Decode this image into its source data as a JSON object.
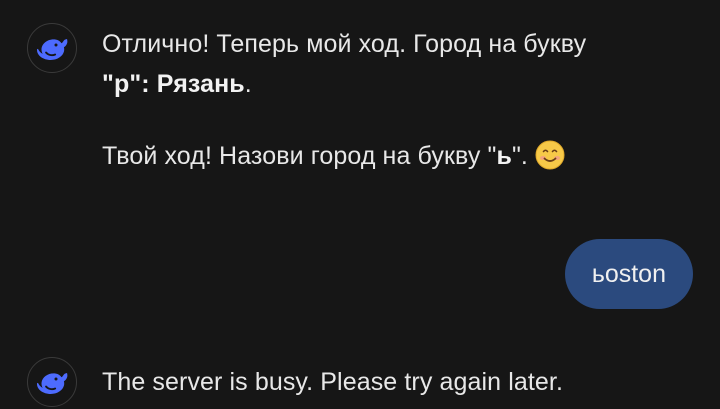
{
  "messages": {
    "bot1": {
      "line1": "Отлично! Теперь мой ход. Город на букву",
      "q1": "\"",
      "letter1": "р",
      "q2": "\": ",
      "city": "Рязань",
      "dot1": ".",
      "line3a": "Твой ход! Назови город на букву \"",
      "letter2": "ь",
      "line3b": "\". ",
      "emoji": "smiling-face-emoji"
    },
    "user1": {
      "text": "ьoston"
    },
    "bot2": {
      "text": "The server is busy. Please try again later."
    }
  },
  "icons": {
    "avatar": "deepseek-whale-icon"
  },
  "colors": {
    "background": "#161616",
    "user_bubble": "#2b4a7e",
    "avatar_accent": "#4d6bfe"
  }
}
